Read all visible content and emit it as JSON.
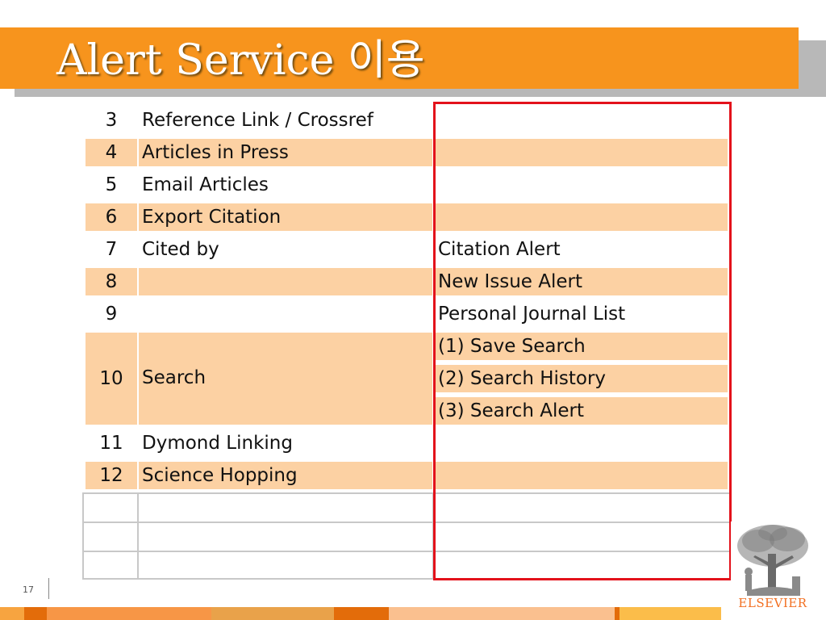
{
  "slide": {
    "title": "Alert Service 이용",
    "page_number": "17"
  },
  "table": {
    "rows": [
      {
        "num": "3",
        "feature": "Reference Link / Crossref",
        "alert": ""
      },
      {
        "num": "4",
        "feature": "Articles in Press",
        "alert": ""
      },
      {
        "num": "5",
        "feature": "Email Articles",
        "alert": ""
      },
      {
        "num": "6",
        "feature": "Export Citation",
        "alert": ""
      },
      {
        "num": "7",
        "feature": "Cited by",
        "alert": "Citation Alert"
      },
      {
        "num": "8",
        "feature": "",
        "alert": "New Issue Alert"
      },
      {
        "num": "9",
        "feature": "",
        "alert": "Personal Journal List"
      },
      {
        "num": "10",
        "feature": "Search",
        "alerts": [
          "(1) Save Search",
          "(2) Search History",
          "(3) Search Alert"
        ]
      },
      {
        "num": "11",
        "feature": "Dymond Linking",
        "alert": ""
      },
      {
        "num": "12",
        "feature": "Science Hopping",
        "alert": ""
      }
    ]
  },
  "logo": {
    "brand": "ELSEVIER",
    "icon": "elsevier-tree-icon"
  },
  "colors": {
    "title_bar": "#f7941d",
    "row_highlight": "#fcd1a3",
    "highlight_frame": "#e3121b",
    "brand_orange": "#f26f21"
  }
}
